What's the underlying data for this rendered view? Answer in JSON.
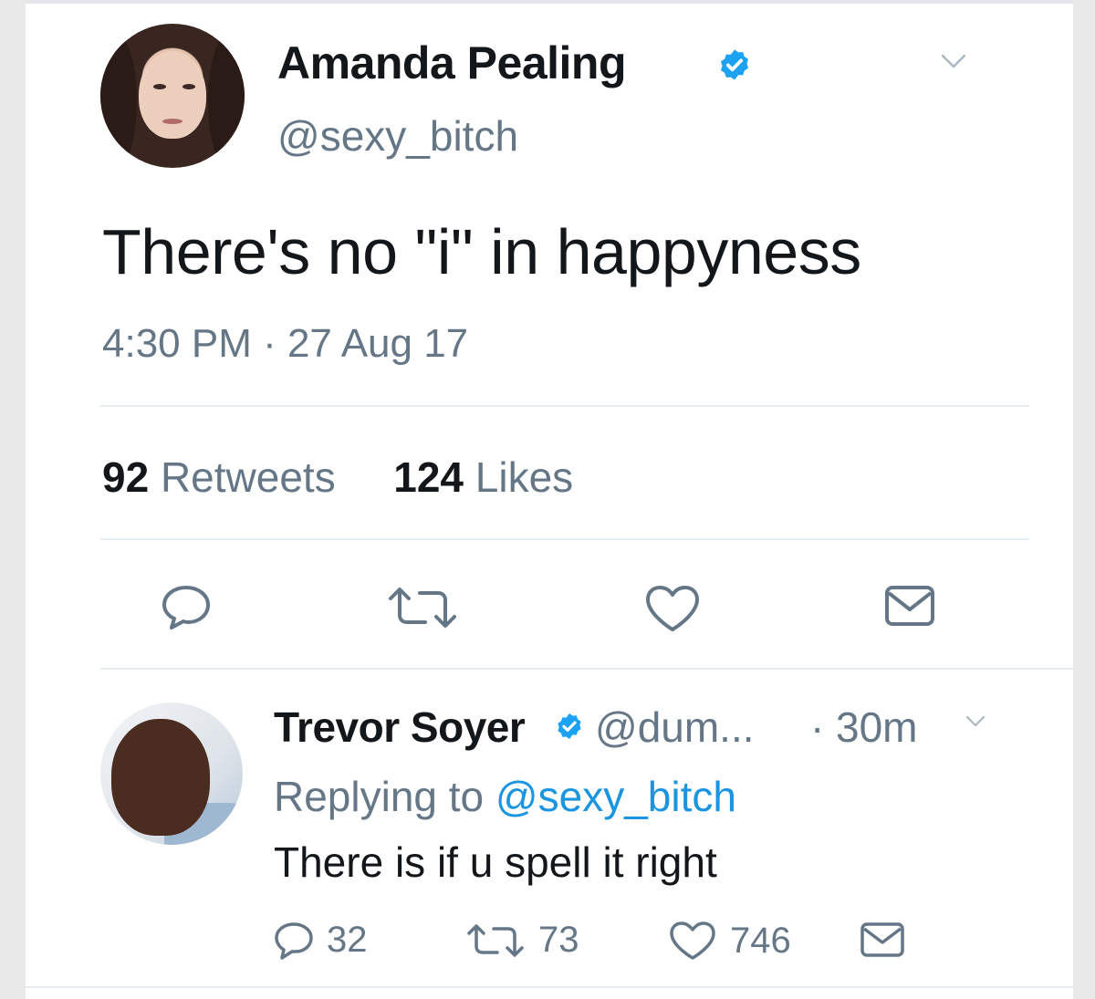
{
  "tweet": {
    "author_name": "Amanda Pealing",
    "author_handle": "@sexy_bitch",
    "text": "There's no \"i\" in happyness",
    "timestamp": "4:30 PM · 27 Aug 17",
    "retweets_count": "92",
    "retweets_label": "Retweets",
    "likes_count": "124",
    "likes_label": "Likes"
  },
  "reply": {
    "author_name": "Trevor Soyer",
    "author_handle": "@dum...",
    "separator": "·",
    "time": "30m",
    "replying_prefix": "Replying to",
    "replying_mention": "@sexy_bitch",
    "text": "There is if u spell it right",
    "reply_count": "32",
    "retweet_count": "73",
    "like_count": "746"
  },
  "colors": {
    "text_primary": "#14171a",
    "text_secondary": "#657786",
    "link": "#1b95e0",
    "verified": "#1da1f2",
    "divider": "#e6ecf0"
  },
  "icons": {
    "verified": "verified-badge-icon",
    "caret": "chevron-down-icon",
    "reply": "reply-icon",
    "retweet": "retweet-icon",
    "like": "heart-icon",
    "dm": "envelope-icon"
  }
}
